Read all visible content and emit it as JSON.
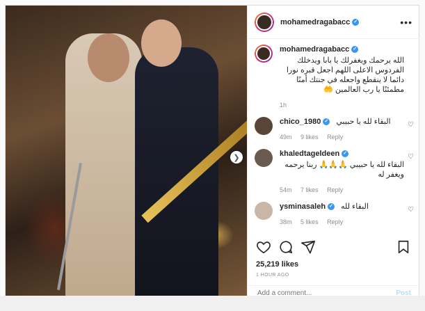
{
  "header": {
    "username": "mohamedragabacc"
  },
  "caption": {
    "username": "mohamedragabacc",
    "text": "الله يرحمك ويغفرلك يا بابا ويدخلك الفردوس الاعلى اللهم اجعل قبره نورا دائما لا ينقطع واجعله في جنتك أمنًا مطمئنًا يا رب العالمين 🤲",
    "time": "1h"
  },
  "comments": [
    {
      "username": "chico_1980",
      "text": "البقاء لله يا حبيبي",
      "time": "49m",
      "likes": "9 likes",
      "reply": "Reply"
    },
    {
      "username": "khaledtageldeen",
      "text": "البقاء لله يا حبيبي 🙏🙏🙏 ربنا يرحمه ويغفر له",
      "time": "54m",
      "likes": "7 likes",
      "reply": "Reply"
    },
    {
      "username": "ysminasaleh",
      "text": "البقاء لله",
      "time": "38m",
      "likes": "5 likes",
      "reply": "Reply"
    }
  ],
  "likes": "25,219 likes",
  "time_ago": "1 HOUR AGO",
  "add_comment": {
    "placeholder": "Add a comment...",
    "post_label": "Post"
  },
  "icons": {
    "more": "more-options-icon",
    "verified": "verified-badge-icon",
    "like": "heart-icon",
    "comment": "comment-icon",
    "share": "share-icon",
    "save": "bookmark-icon",
    "next": "chevron-right-icon"
  },
  "colors": {
    "verified": "#3897f0",
    "post_button": "#b2dffc",
    "muted": "#8e8e8e"
  }
}
